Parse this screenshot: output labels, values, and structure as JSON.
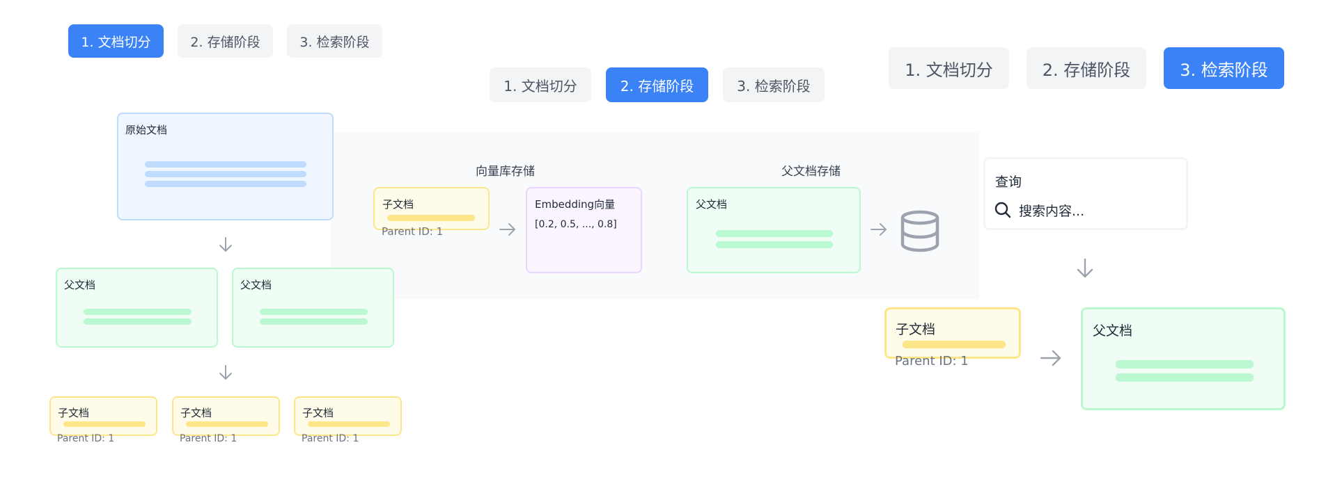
{
  "tabs": {
    "split": "1. 文档切分",
    "store": "2. 存储阶段",
    "retrieve": "3. 检索阶段"
  },
  "split_stage": {
    "original_doc": "原始文档",
    "parent_docs": [
      "父文档",
      "父文档"
    ],
    "child_docs": [
      {
        "title": "子文档",
        "parent_id": "Parent ID: 1"
      },
      {
        "title": "子文档",
        "parent_id": "Parent ID: 1"
      },
      {
        "title": "子文档",
        "parent_id": "Parent ID: 1"
      }
    ]
  },
  "store_stage": {
    "vector_store_title": "向量库存储",
    "parent_store_title": "父文档存储",
    "child_doc": {
      "title": "子文档",
      "parent_id": "Parent ID: 1"
    },
    "embedding": {
      "title": "Embedding向量",
      "value": "[0.2, 0.5, ..., 0.8]"
    },
    "parent_doc": "父文档"
  },
  "retrieve_stage": {
    "query_title": "查询",
    "search_placeholder": "搜索内容...",
    "child_doc": {
      "title": "子文档",
      "parent_id": "Parent ID: 1"
    },
    "parent_doc": "父文档"
  },
  "colors": {
    "accent": "#3b82f6",
    "tab_inactive": "#f3f4f6",
    "blue_box": "#eff6ff",
    "green_box": "#f0fdf4",
    "yellow_box": "#fefce8",
    "purple_box": "#faf5ff"
  },
  "icons": {
    "arrow_down": "arrow-down-icon",
    "arrow_right": "arrow-right-icon",
    "database": "database-icon",
    "search": "search-icon"
  }
}
